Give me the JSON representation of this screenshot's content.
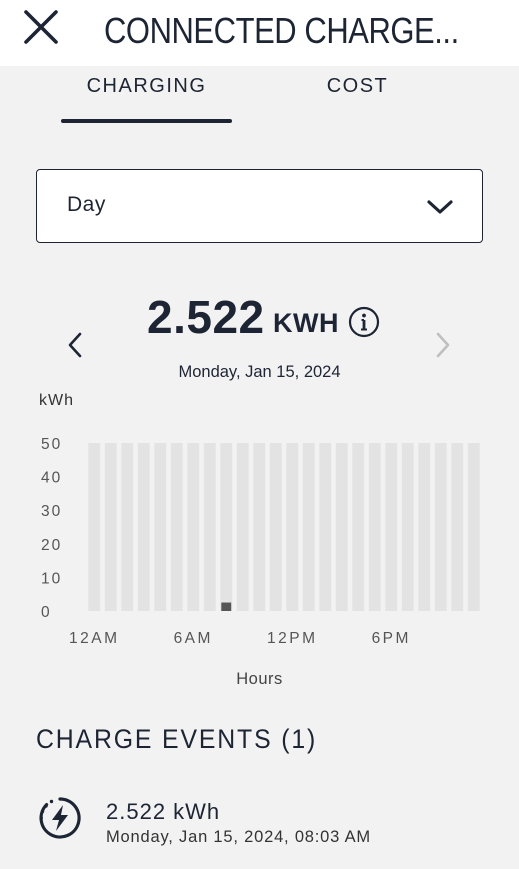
{
  "header": {
    "title": "CONNECTED CHARGE..."
  },
  "tabs": [
    {
      "label": "CHARGING",
      "selected": true
    },
    {
      "label": "COST",
      "selected": false
    }
  ],
  "period_select": {
    "value": "Day"
  },
  "summary": {
    "total_value": "2.522",
    "total_unit": "KWH",
    "date": "Monday, Jan 15, 2024"
  },
  "chart_data": {
    "type": "bar",
    "title": "",
    "ylabel": "kWh",
    "xlabel": "Hours",
    "ylim": [
      0,
      50
    ],
    "yticks": [
      "50",
      "40",
      "30",
      "20",
      "10",
      "0"
    ],
    "xticks": [
      "12AM",
      "6AM",
      "12PM",
      "6PM"
    ],
    "categories": [
      "0",
      "1",
      "2",
      "3",
      "4",
      "5",
      "6",
      "7",
      "8",
      "9",
      "10",
      "11",
      "12",
      "13",
      "14",
      "15",
      "16",
      "17",
      "18",
      "19",
      "20",
      "21",
      "22",
      "23"
    ],
    "values": [
      0,
      0,
      0,
      0,
      0,
      0,
      0,
      0,
      2.522,
      0,
      0,
      0,
      0,
      0,
      0,
      0,
      0,
      0,
      0,
      0,
      0,
      0,
      0,
      0
    ],
    "background_bar_color": "#e3e3e3",
    "value_bar_color": "#555555"
  },
  "events": {
    "title": "CHARGE EVENTS (1)",
    "items": [
      {
        "value": "2.522 kWh",
        "datetime": "Monday, Jan 15, 2024, 08:03 AM",
        "icon": "charging-bolt-icon"
      }
    ]
  },
  "colors": {
    "primary": "#1d2433",
    "background": "#f2f2f2",
    "header_background": "#ffffff",
    "disabled_arrow": "#bfbfbf"
  }
}
